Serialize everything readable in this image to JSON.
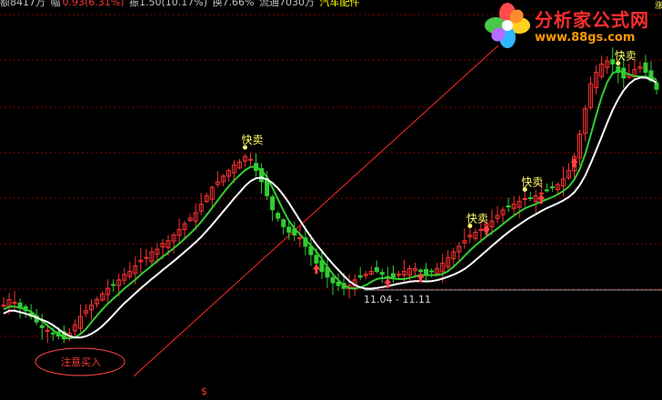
{
  "header": {
    "parts": [
      {
        "text": "额8417万 ",
        "color": "grey"
      },
      {
        "text": "幅",
        "color": "grey"
      },
      {
        "text": "0.93(6.31%)",
        "color": "red"
      },
      {
        "text": " 振1.50(10.17%) ",
        "color": "grey"
      },
      {
        "text": "换7.66% ",
        "color": "grey"
      },
      {
        "text": "流通7030万 ",
        "color": "grey"
      },
      {
        "text": "汽车配件",
        "color": "yellow"
      }
    ],
    "corner_glyph": "涨"
  },
  "logo": {
    "title": "分析家公式网",
    "url": "www.88gs.com"
  },
  "signals": {
    "sell_label": "快卖",
    "buy_label": "注意买入",
    "range_label": "11.04 - 11.11",
    "footer_mark": "$"
  },
  "colors": {
    "background": "#000000",
    "up_candle": "#ff3232",
    "down_candle": "#32cd32",
    "ma_fast": "#32cd32",
    "ma_slow": "#ffffff",
    "grid": "#8b0000",
    "trend_line": "#ff2a2a",
    "sell_marker": "#ffff66",
    "buy_marker": "#ff4444"
  },
  "icons": {
    "logo": "pinwheel-flower-icon",
    "buy_arrow": "up-arrow-icon",
    "sell_marker": "sell-marker-icon"
  },
  "chart_data": {
    "type": "candlestick",
    "series": [
      {
        "name": "price-close",
        "values": [
          70,
          72,
          71,
          69,
          68,
          66,
          64,
          62,
          61,
          60,
          59,
          58,
          60,
          63,
          66,
          68,
          70,
          72,
          74,
          76,
          77,
          79,
          81,
          82,
          84,
          86,
          87,
          89,
          90,
          92,
          93,
          95,
          97,
          99,
          101,
          103,
          106,
          109,
          112,
          114,
          116,
          118,
          120,
          121,
          123,
          122,
          118,
          114,
          109,
          104,
          101,
          98,
          96,
          95,
          94,
          91,
          88,
          85,
          82,
          80,
          78,
          77,
          76,
          77,
          79,
          80,
          81,
          82,
          82,
          81,
          80,
          80,
          81,
          82,
          83,
          83,
          82,
          81,
          82,
          83,
          85,
          87,
          89,
          91,
          93,
          95,
          96,
          97,
          99,
          100,
          102,
          104,
          105,
          106,
          107,
          108,
          108,
          109,
          110,
          111,
          112,
          113,
          115,
          118,
          123,
          131,
          140,
          149,
          153,
          156,
          157,
          156,
          153,
          151,
          152,
          154,
          155,
          153,
          150,
          147
        ]
      }
    ]
  }
}
